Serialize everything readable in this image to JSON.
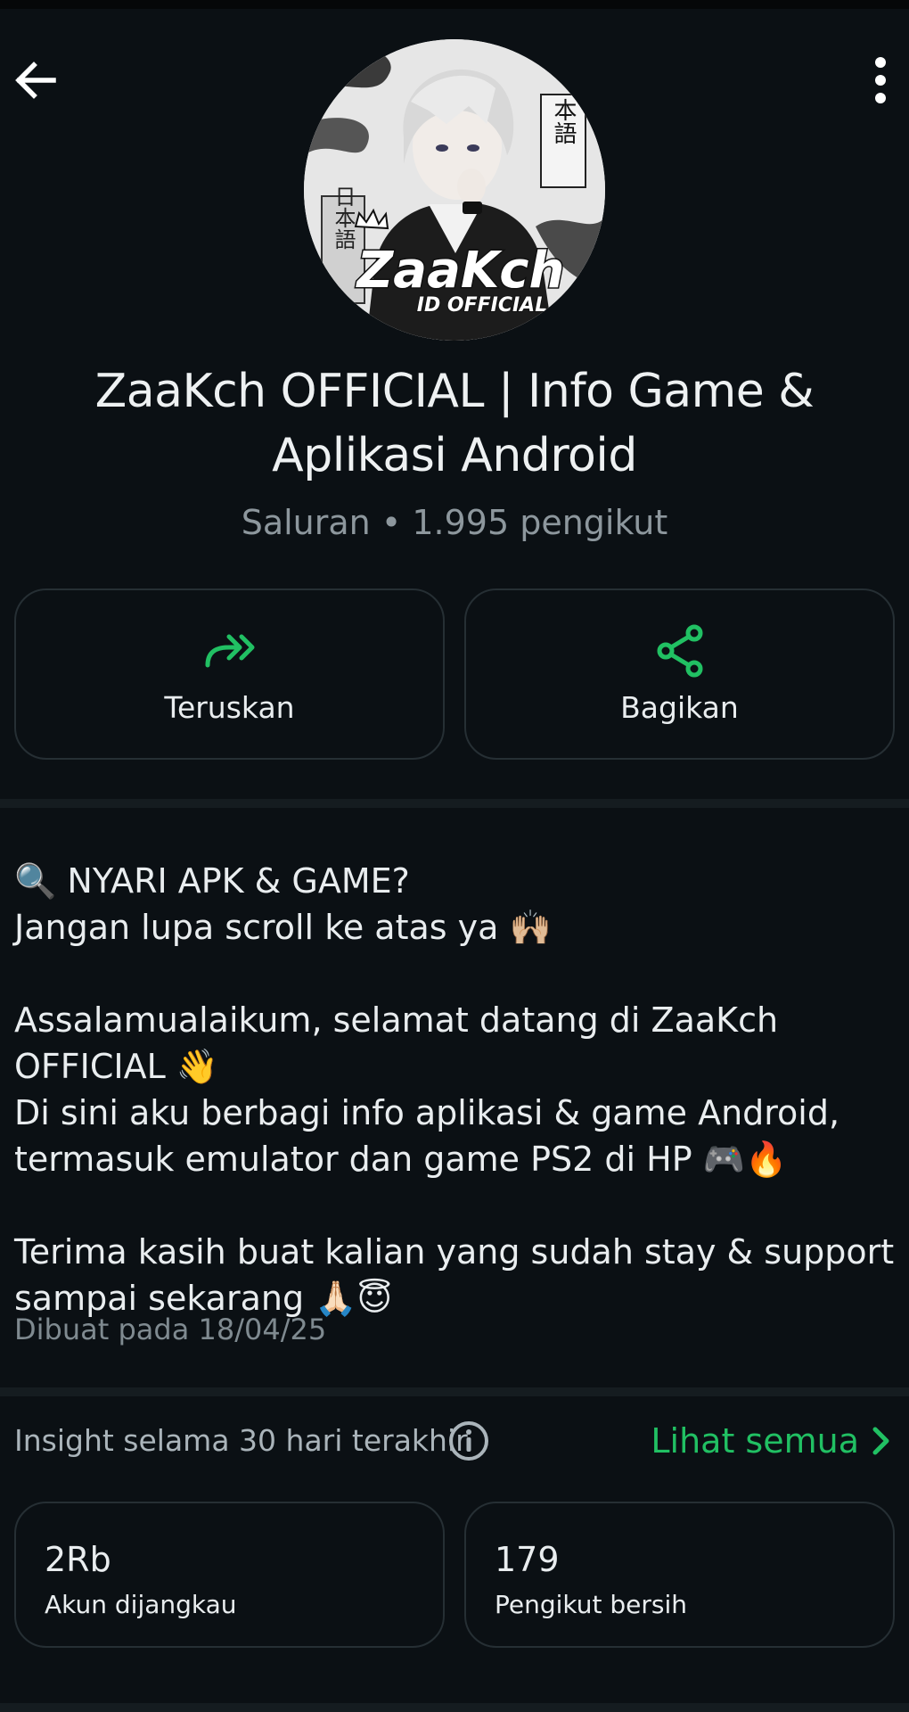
{
  "header": {
    "back_icon": "arrow-left-icon",
    "menu_icon": "more-vertical-icon"
  },
  "avatar": {
    "logo_text": "ZaaKch",
    "logo_subtext": "ID OFFICIAL",
    "kanji_top": "本語",
    "kanji_left": "日本語"
  },
  "channel": {
    "title": "ZaaKch OFFICIAL | Info Game & Aplikasi Android",
    "meta": "Saluran • 1.995 pengikut"
  },
  "actions": [
    {
      "label": "Teruskan",
      "icon": "forward-icon"
    },
    {
      "label": "Bagikan",
      "icon": "share-icon"
    }
  ],
  "description": {
    "text": "🔍 NYARI APK & GAME?\nJangan lupa scroll ke atas ya 🙌🏼\n\nAssalamualaikum, selamat datang di ZaaKch OFFICIAL 👋\nDi sini aku berbagi info aplikasi & game Android, termasuk emulator dan game PS2 di HP 🎮🔥\n\nTerima kasih buat kalian yang sudah stay & support sampai sekarang 🙏🏻😇",
    "created": "Dibuat pada 18/04/25"
  },
  "insights": {
    "label": "Insight selama 30 hari terakhir",
    "see_all": "Lihat semua",
    "cards": [
      {
        "value": "2Rb",
        "caption": "Akun dijangkau"
      },
      {
        "value": "179",
        "caption": "Pengikut bersih"
      }
    ]
  },
  "colors": {
    "background": "#0b1014",
    "accent": "#21c063",
    "card_border": "#262f34",
    "muted_text": "#8d979d"
  }
}
